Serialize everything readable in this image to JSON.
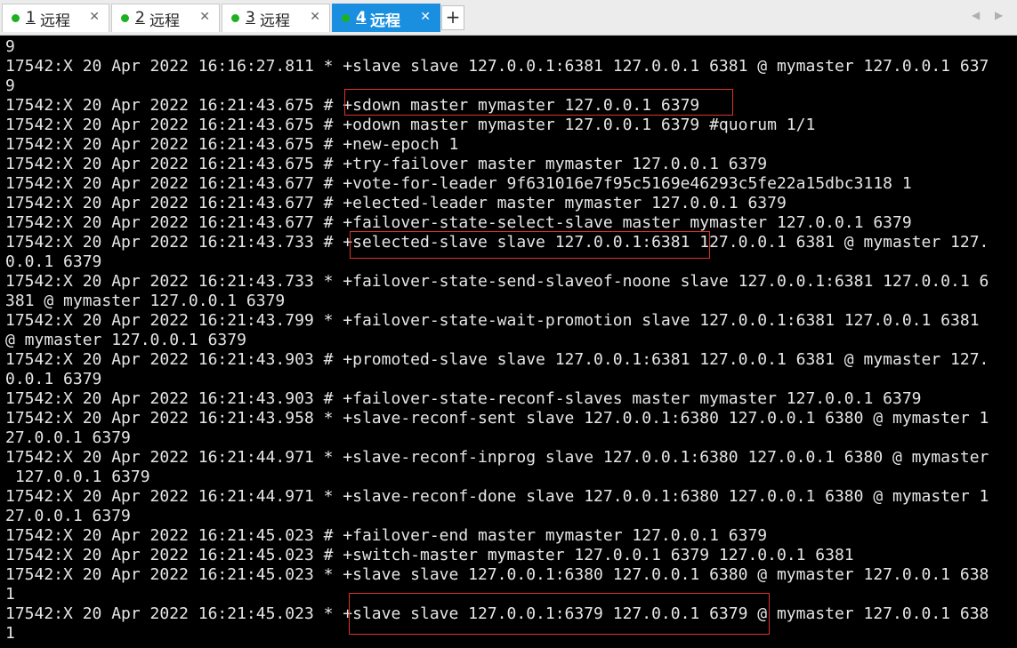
{
  "tabs": [
    {
      "num": "1",
      "name": "远程",
      "close": "✕",
      "active": false
    },
    {
      "num": "2",
      "name": "远程",
      "close": "✕",
      "active": false
    },
    {
      "num": "3",
      "name": "远程",
      "close": "✕",
      "active": false
    },
    {
      "num": "4",
      "name": "远程",
      "close": "✕",
      "active": true
    }
  ],
  "new_tab_label": "+",
  "scroll_left": "◀",
  "scroll_right": "▶",
  "colors": {
    "active_tab": "#1a8fe0",
    "status_dot": "#1db022",
    "highlight": "#e0322b"
  },
  "terminal_lines": [
    "9",
    "17542:X 20 Apr 2022 16:16:27.811 * +slave slave 127.0.0.1:6381 127.0.0.1 6381 @ mymaster 127.0.0.1 637",
    "9",
    "17542:X 20 Apr 2022 16:21:43.675 # +sdown master mymaster 127.0.0.1 6379",
    "17542:X 20 Apr 2022 16:21:43.675 # +odown master mymaster 127.0.0.1 6379 #quorum 1/1",
    "17542:X 20 Apr 2022 16:21:43.675 # +new-epoch 1",
    "17542:X 20 Apr 2022 16:21:43.675 # +try-failover master mymaster 127.0.0.1 6379",
    "17542:X 20 Apr 2022 16:21:43.677 # +vote-for-leader 9f631016e7f95c5169e46293c5fe22a15dbc3118 1",
    "17542:X 20 Apr 2022 16:21:43.677 # +elected-leader master mymaster 127.0.0.1 6379",
    "17542:X 20 Apr 2022 16:21:43.677 # +failover-state-select-slave master mymaster 127.0.0.1 6379",
    "17542:X 20 Apr 2022 16:21:43.733 # +selected-slave slave 127.0.0.1:6381 127.0.0.1 6381 @ mymaster 127.",
    "0.0.1 6379",
    "17542:X 20 Apr 2022 16:21:43.733 * +failover-state-send-slaveof-noone slave 127.0.0.1:6381 127.0.0.1 6",
    "381 @ mymaster 127.0.0.1 6379",
    "17542:X 20 Apr 2022 16:21:43.799 * +failover-state-wait-promotion slave 127.0.0.1:6381 127.0.0.1 6381",
    "@ mymaster 127.0.0.1 6379",
    "17542:X 20 Apr 2022 16:21:43.903 # +promoted-slave slave 127.0.0.1:6381 127.0.0.1 6381 @ mymaster 127.",
    "0.0.1 6379",
    "17542:X 20 Apr 2022 16:21:43.903 # +failover-state-reconf-slaves master mymaster 127.0.0.1 6379",
    "17542:X 20 Apr 2022 16:21:43.958 * +slave-reconf-sent slave 127.0.0.1:6380 127.0.0.1 6380 @ mymaster 1",
    "27.0.0.1 6379",
    "17542:X 20 Apr 2022 16:21:44.971 * +slave-reconf-inprog slave 127.0.0.1:6380 127.0.0.1 6380 @ mymaster",
    " 127.0.0.1 6379",
    "17542:X 20 Apr 2022 16:21:44.971 * +slave-reconf-done slave 127.0.0.1:6380 127.0.0.1 6380 @ mymaster 1",
    "27.0.0.1 6379",
    "17542:X 20 Apr 2022 16:21:45.023 # +failover-end master mymaster 127.0.0.1 6379",
    "17542:X 20 Apr 2022 16:21:45.023 # +switch-master mymaster 127.0.0.1 6379 127.0.0.1 6381",
    "17542:X 20 Apr 2022 16:21:45.023 * +slave slave 127.0.0.1:6380 127.0.0.1 6380 @ mymaster 127.0.0.1 638",
    "1",
    "17542:X 20 Apr 2022 16:21:45.023 * +slave slave 127.0.0.1:6379 127.0.0.1 6379 @ mymaster 127.0.0.1 638",
    "1"
  ]
}
